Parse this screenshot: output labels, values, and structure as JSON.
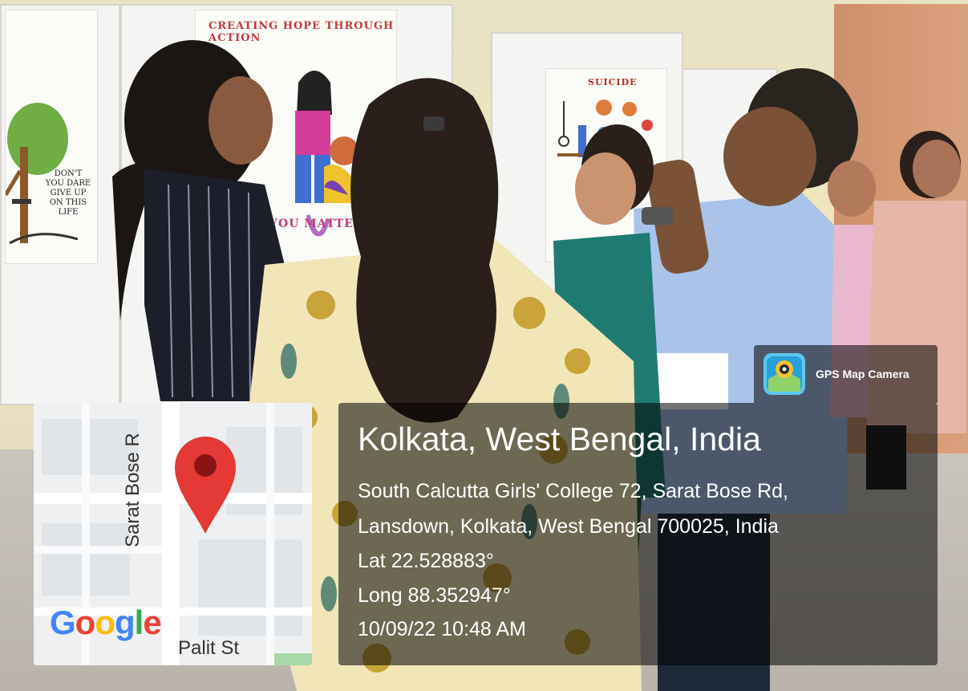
{
  "overlay": {
    "brand": {
      "name": "GPS Map Camera",
      "icon": "gps-map-camera-icon"
    },
    "location": {
      "title": "Kolkata, West Bengal, India",
      "address_line1": "South Calcutta Girls' College 72, Sarat Bose Rd,",
      "address_line2": "Lansdown, Kolkata, West Bengal 700025, India",
      "lat": "Lat 22.528883°",
      "long": "Long 88.352947°",
      "datetime": "10/09/22 10:48 AM"
    },
    "map": {
      "road_vertical": "Sarat Bose R",
      "road_bottom": "Palit St",
      "logo": [
        "G",
        "o",
        "o",
        "g",
        "l",
        "e"
      ],
      "logo_colors": [
        "#4285F4",
        "#EA4335",
        "#FBBC05",
        "#4285F4",
        "#34A853",
        "#EA4335"
      ],
      "pin_color": "#E53935"
    }
  },
  "photo": {
    "poster_texts": {
      "creating_hope": "CREATING HOPE THROUGH ACTION",
      "suicide": "SUICIDE",
      "dont_give_up": "DON'T YOU DARE GIVE UP ON THIS LIFE",
      "you_matter": "YOU MATTER"
    }
  }
}
